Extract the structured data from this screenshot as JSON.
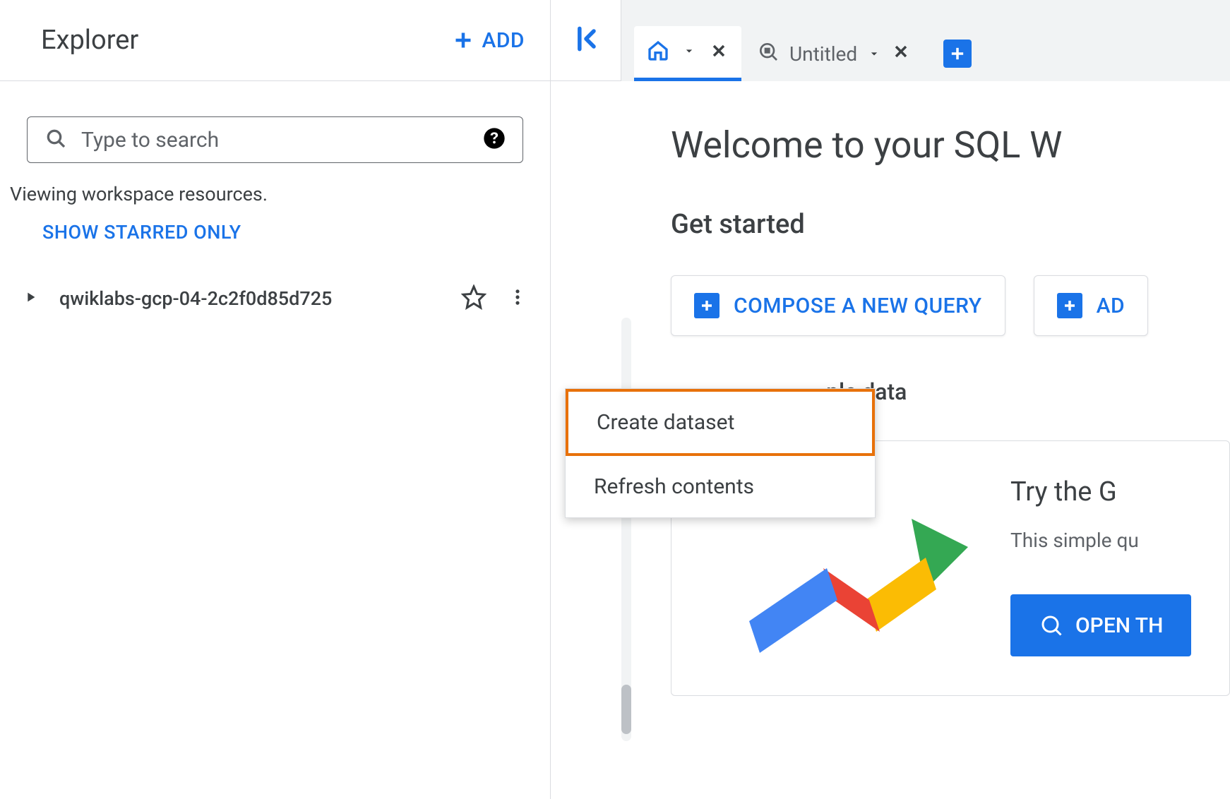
{
  "explorer": {
    "title": "Explorer",
    "add_button": "ADD",
    "search_placeholder": "Type to search",
    "viewing_text": "Viewing workspace resources.",
    "show_starred": "SHOW STARRED ONLY",
    "project_name": "qwiklabs-gcp-04-2c2f0d85d725"
  },
  "tabs": {
    "untitled_label": "Untitled"
  },
  "main": {
    "welcome_title": "Welcome to your SQL W",
    "get_started": "Get started",
    "compose_query": "COMPOSE A NEW QUERY",
    "add_data": "AD",
    "sample_data_label": "ple data",
    "try_google": "Try the G",
    "sample_desc": "This simple qu",
    "open_button": "OPEN TH"
  },
  "context_menu": {
    "create_dataset": "Create dataset",
    "refresh_contents": "Refresh contents"
  }
}
